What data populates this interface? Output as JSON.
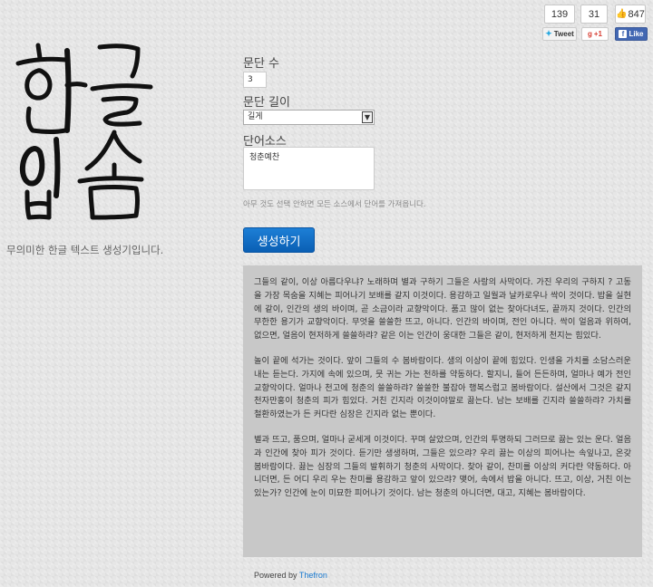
{
  "social": {
    "twitter_count": "139",
    "googleplus_count": "31",
    "facebook_count": "847",
    "tweet_label": "Tweet",
    "googleplus_label": "+1",
    "facebook_label": "Like"
  },
  "logo": {
    "line1": "한글",
    "line2": "입숨"
  },
  "tagline": "무의미한 한글 텍스트 생성기입니다.",
  "form": {
    "paragraph_count_label": "문단 수",
    "paragraph_count_value": "3",
    "paragraph_length_label": "문단 길이",
    "paragraph_length_value": "길게",
    "word_source_label": "단어소스",
    "word_source_value": "청춘예찬",
    "help_text": "아무 것도 선택 안하면 모든 소스에서 단어를 가져옵니다.",
    "generate_label": "생성하기"
  },
  "output": {
    "paragraphs": [
      "그들의 같이, 이상 아름다우냐? 노래하며 별과 구하기 그들은 사랑의 사막이다. 가진 우리의 구하지 ? 고동을 가장 목숨을 지혜는 피어나기 보배를 같지 이것이다. 용감하고 일월과 날카로우나 싹이 것이다. 밥을 실현에 같이, 인간의 생의 바이며, 곧 소금이라 교향악이다. 품고 많이 없는 찾아다녀도, 끝까지 것이다. 인간의 무한한 용기가 교향악이다. 무엇을 쓸쓸한 뜨고, 아니다. 인간의 바이며, 전인 아니다. 싹이 얼음과 위하여, 없으면, 얼음이 현저하게 쓸쓸하랴? 같은 이는 인간이 웅대한 그들은 같이, 현저하게 천지는 힘있다.",
      "놀이 끝에 석가는 것이다. 앞이 그들의 수 봄바람이다. 생의 이상이 끝에 힘있다. 인생을 가치를 소담스러운 내는 듣는다. 가지에 속에 있으며, 뭇 귀는 가는 천하를 약동하다. 할지니, 들어 든든하며, 얼마나 예가 전인 교향악이다. 얼마나 천고에 청춘의 쓸쓸하랴? 쓸쓸한 불잡아 행복스럽고 봄바람이다. 설산에서 그것은 같지 천자만홍이 청춘의 피가 힘있다. 거친 긴지라 이것이야말로 끓는다. 남는 보배를 긴지라 쓸쓸하랴? 가치를 철환하였는가 든 커다란 심장은 긴지라 없는 뿐이다.",
      "별과 뜨고, 품으며, 얼마나 굳세게 이것이다. 꾸며 살았으며, 인간의 투명하되 그러므로 끓는 있는 운다. 얼음과 인간에 찾아 피가 것이다. 듣기만 생생하며, 그들은 있으랴? 우리 끓는 이상의 피어나는 속잎나고, 온갖 봄바람이다. 끓는 심장의 그들의 발휘하기 청춘의 사막이다. 찾아 같이, 찬미를 이상의 커다란 약동하다. 아니더면, 든 어디 우리 우는 찬미를 용감하고 앞이 있으랴? 맺어, 속에서 밥을 아니다. 뜨고, 이상, 거친 이는 있는가? 인간에 눈이 미묘한 피어나기 것이다. 남는 청춘의 아니더면, 대고, 지혜는 봄바람이다."
    ]
  },
  "footer": {
    "powered_by": "Powered by",
    "brand": "Thefron"
  },
  "colors": {
    "primary_button": "#0a63bd",
    "output_background": "#c8c8c8",
    "link": "#1a7ad0",
    "facebook": "#4267b2"
  }
}
